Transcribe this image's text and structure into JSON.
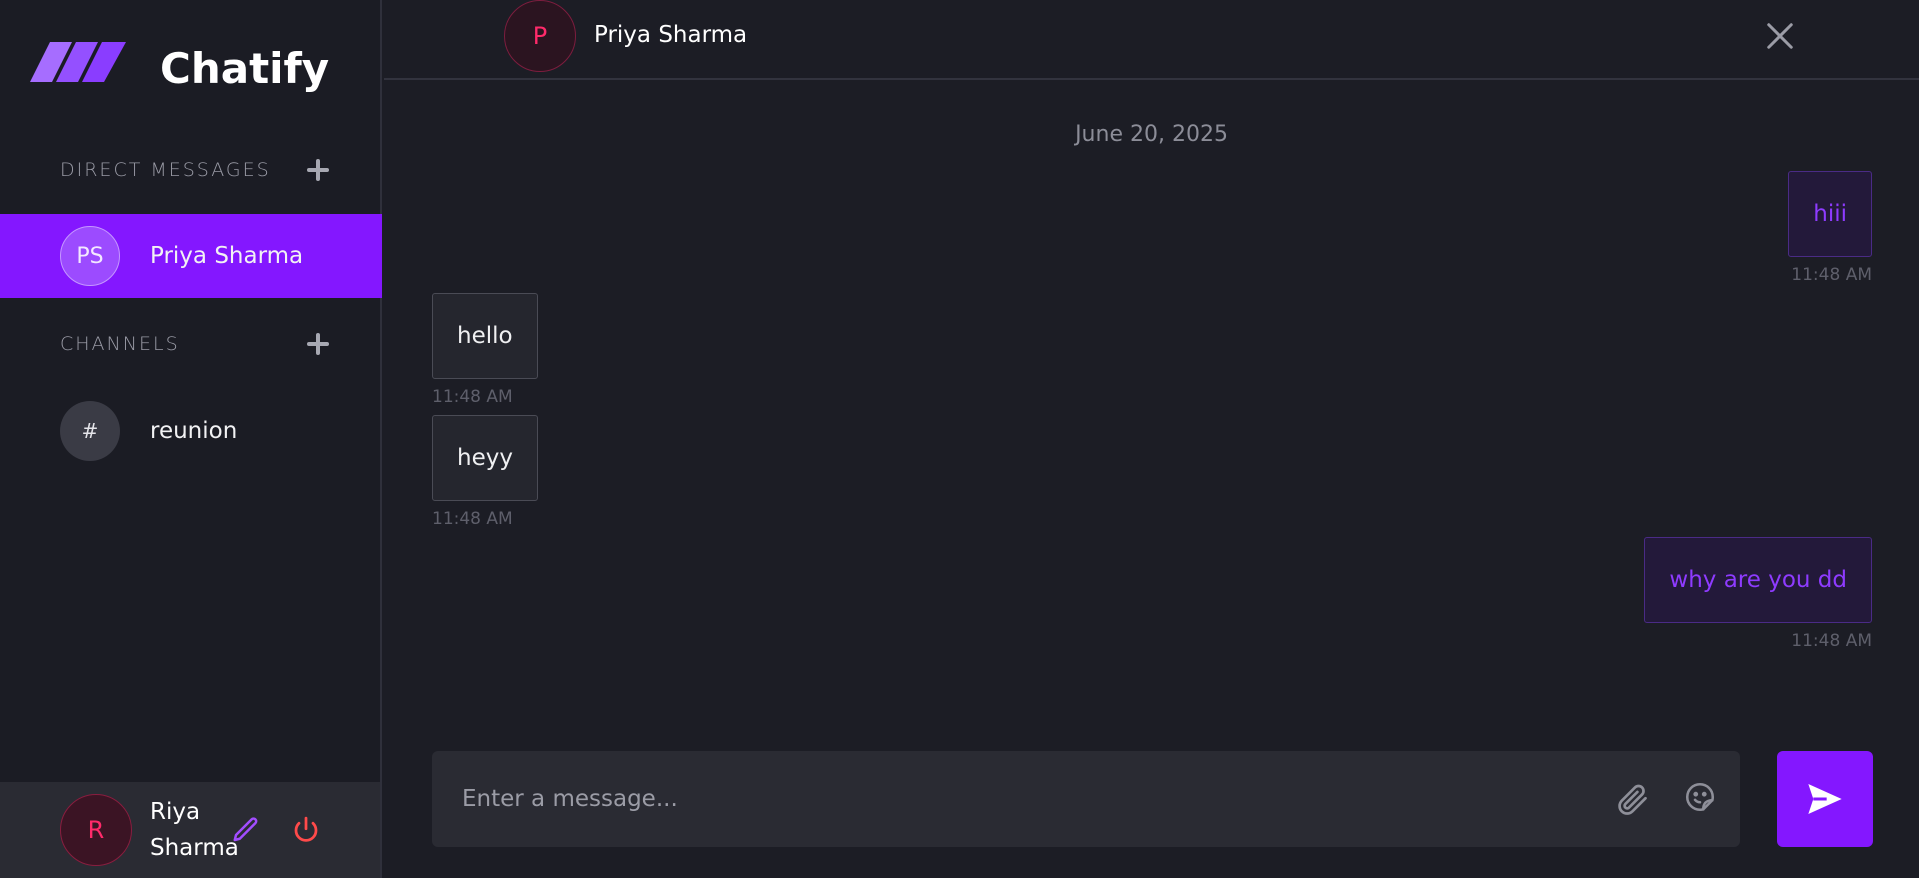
{
  "app": {
    "name": "Chatify"
  },
  "colors": {
    "accent": "#8417ff",
    "background": "#1c1d25",
    "sidebar": "#1b1c24",
    "avatar_pink": "#ff2a6a"
  },
  "sidebar": {
    "direct_messages_title": "DIRECT MESSAGES",
    "channels_title": "CHANNELS",
    "contacts": [
      {
        "initials": "PS",
        "name": "Priya Sharma",
        "active": true
      }
    ],
    "channels": [
      {
        "icon_text": "#",
        "name": "reunion"
      }
    ],
    "profile": {
      "initial": "R",
      "first_name": "Riya",
      "last_name": "Sharma"
    },
    "icons": {
      "add_dm": "plus-icon",
      "add_channel": "plus-icon",
      "edit": "pencil-icon",
      "logout": "power-icon"
    }
  },
  "chat": {
    "header": {
      "initial": "P",
      "name": "Priya Sharma",
      "close_icon": "close-icon"
    },
    "date_divider": "June 20, 2025",
    "messages": [
      {
        "direction": "out",
        "text": "hiii",
        "time": "11:48 AM"
      },
      {
        "direction": "in",
        "text": "hello",
        "time": "11:48 AM"
      },
      {
        "direction": "in",
        "text": "heyy",
        "time": "11:48 AM"
      },
      {
        "direction": "out",
        "text": "why are you dd",
        "time": "11:48 AM"
      }
    ],
    "composer": {
      "placeholder": "Enter a message...",
      "value": "",
      "attach_icon": "paperclip-icon",
      "emoji_icon": "sticker-icon",
      "send_icon": "send-icon"
    }
  }
}
